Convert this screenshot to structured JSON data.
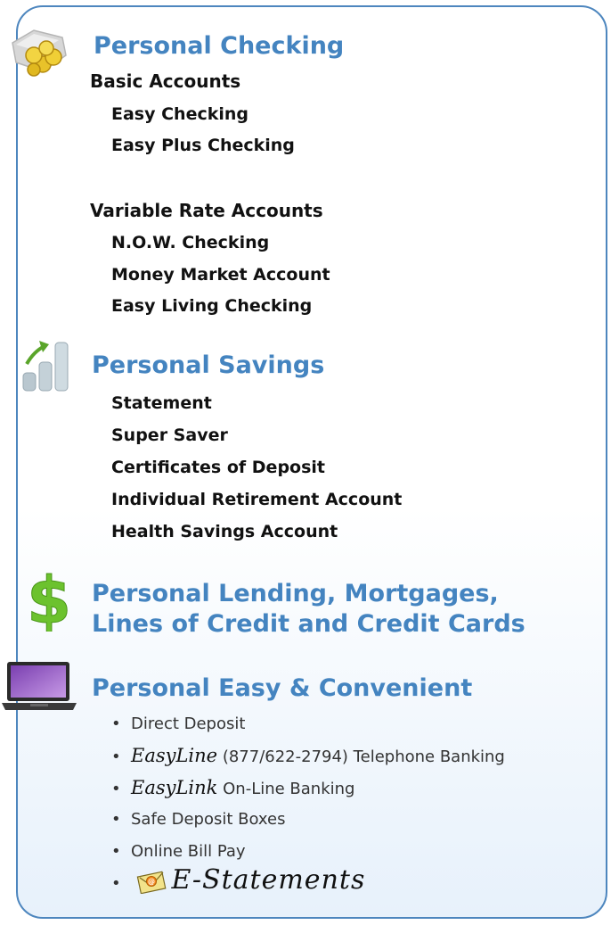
{
  "colors": {
    "accent": "#4484c0",
    "border": "#4d86be",
    "text": "#111111"
  },
  "checking": {
    "title": "Personal Checking",
    "icon": "coins-icon",
    "groups": [
      {
        "label": "Basic Accounts",
        "items": [
          "Easy Checking",
          "Easy Plus Checking"
        ]
      },
      {
        "label": "Variable Rate Accounts",
        "items": [
          "N.O.W. Checking",
          "Money Market Account",
          "Easy Living Checking"
        ]
      }
    ]
  },
  "savings": {
    "title": "Personal Savings",
    "icon": "bar-chart-icon",
    "items": [
      "Statement",
      "Super Saver",
      "Certificates of Deposit",
      "Individual Retirement Account",
      "Health Savings Account"
    ]
  },
  "lending": {
    "icon": "dollar-sign-icon",
    "title_line1": "Personal Lending, Mortgages,",
    "title_line2": "Lines of Credit and Credit Cards"
  },
  "convenient": {
    "title": "Personal Easy & Convenient",
    "icon": "laptop-icon",
    "bullets": {
      "direct_deposit": "Direct Deposit",
      "easyline_name": "EasyLine",
      "easyline_text": " (877/622-2794) Telephone Banking",
      "easylink_name": "EasyLink",
      "easylink_text": " On-Line Banking",
      "safe_deposit": "Safe Deposit Boxes",
      "bill_pay": "Online Bill Pay",
      "estatements": "E-Statements",
      "estatements_icon": "email-envelope-icon"
    }
  }
}
